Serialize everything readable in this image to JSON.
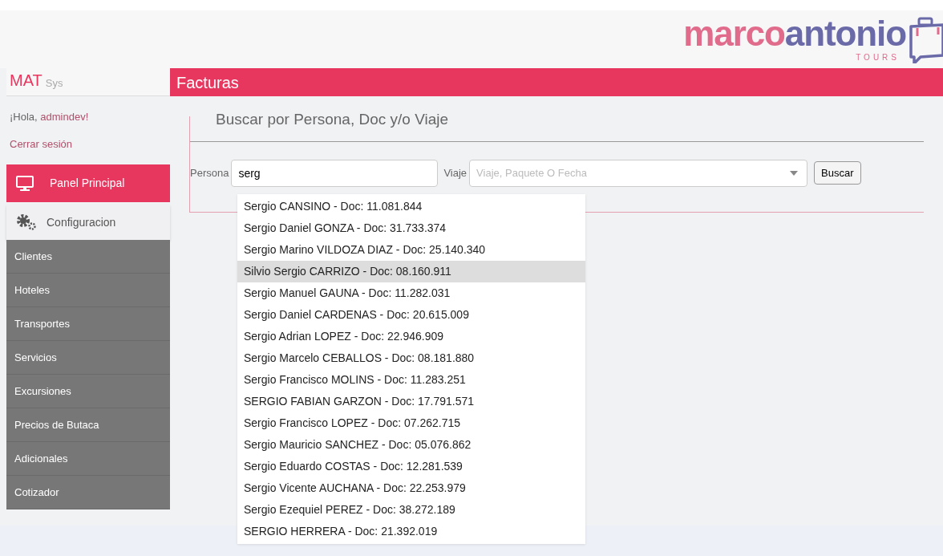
{
  "logo": {
    "part_1": "marco",
    "part_2": "antonio",
    "tagline": "TOURS"
  },
  "sidebar": {
    "brand": "MAT",
    "brand_suffix": "Sys",
    "greeting": "¡Hola, ",
    "user": "admindev!",
    "logout": "Cerrar sesión",
    "items": [
      {
        "label": "Panel Principal",
        "kind": "primary",
        "selected": true
      },
      {
        "label": "Configuracion",
        "kind": "section",
        "selected": false
      },
      {
        "label": "Clientes",
        "kind": "sub",
        "selected": false
      },
      {
        "label": "Hoteles",
        "kind": "sub",
        "selected": false
      },
      {
        "label": "Transportes",
        "kind": "sub",
        "selected": false
      },
      {
        "label": "Servicios",
        "kind": "sub",
        "selected": false
      },
      {
        "label": "Excursiones",
        "kind": "sub",
        "selected": false
      },
      {
        "label": "Precios de Butaca",
        "kind": "sub",
        "selected": false
      },
      {
        "label": "Adicionales",
        "kind": "sub",
        "selected": false
      },
      {
        "label": "Cotizador",
        "kind": "sub",
        "selected": false
      }
    ]
  },
  "page_title": "Facturas",
  "search": {
    "legend": "Buscar por Persona, Doc y/o Viaje",
    "persona_label": "Persona",
    "persona_value": "serg",
    "viaje_label": "Viaje",
    "viaje_placeholder": "Viaje, Paquete O Fecha",
    "button": "Buscar",
    "suggestions": [
      {
        "label": "Sergio CANSINO - Doc: 11.081.844",
        "selected": false
      },
      {
        "label": "Sergio Daniel GONZA - Doc: 31.733.374",
        "selected": false
      },
      {
        "label": "Sergio Marino VILDOZA DIAZ - Doc: 25.140.340",
        "selected": false
      },
      {
        "label": "Silvio Sergio CARRIZO - Doc: 08.160.911",
        "selected": true
      },
      {
        "label": "Sergio Manuel GAUNA - Doc: 11.282.031",
        "selected": false
      },
      {
        "label": "Sergio Daniel CARDENAS - Doc: 20.615.009",
        "selected": false
      },
      {
        "label": "Sergio Adrian LOPEZ - Doc: 22.946.909",
        "selected": false
      },
      {
        "label": "Sergio Marcelo CEBALLOS - Doc: 08.181.880",
        "selected": false
      },
      {
        "label": "Sergio Francisco MOLINS - Doc: 11.283.251",
        "selected": false
      },
      {
        "label": "SERGIO FABIAN GARZON - Doc: 17.791.571",
        "selected": false
      },
      {
        "label": "Sergio Francisco LOPEZ - Doc: 07.262.715",
        "selected": false
      },
      {
        "label": "Sergio Mauricio SANCHEZ - Doc: 05.076.862",
        "selected": false
      },
      {
        "label": "Sergio Eduardo COSTAS - Doc: 12.281.539",
        "selected": false
      },
      {
        "label": "Sergio Vicente AUCHANA - Doc: 22.253.979",
        "selected": false
      },
      {
        "label": "Sergio Ezequiel PEREZ - Doc: 38.272.189",
        "selected": false
      },
      {
        "label": "SERGIO HERRERA - Doc: 21.392.019",
        "selected": false
      }
    ]
  }
}
